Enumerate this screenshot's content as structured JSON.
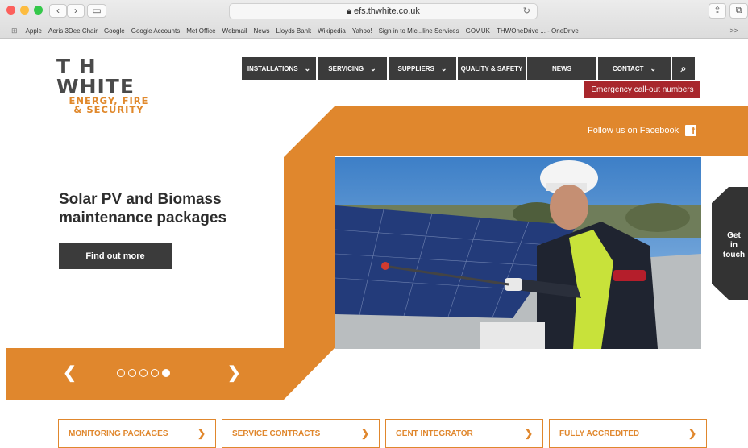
{
  "browser": {
    "url": "efs.thwhite.co.uk",
    "bookmarks": [
      "Apple",
      "Aeris 3Dee Chair",
      "Google",
      "Google Accounts",
      "Met Office",
      "Webmail",
      "News",
      "Lloyds Bank",
      "Wikipedia",
      "Yahoo!",
      "Sign in to Mic...line Services",
      "GOV.UK",
      "THWOneDrive ... - OneDrive"
    ],
    "bookmarks_more": ">>"
  },
  "logo": {
    "top": "T H WHITE",
    "line1": "ENERGY, FIRE",
    "line2": "& SECURITY"
  },
  "nav": {
    "items": [
      {
        "label": "INSTALLATIONS",
        "dropdown": true
      },
      {
        "label": "SERVICING",
        "dropdown": true
      },
      {
        "label": "SUPPLIERS",
        "dropdown": true
      },
      {
        "label": "QUALITY & SAFETY",
        "dropdown": false
      },
      {
        "label": "NEWS",
        "dropdown": false
      },
      {
        "label": "CONTACT",
        "dropdown": true
      }
    ],
    "emergency": "Emergency call-out numbers"
  },
  "social": {
    "follow_label": "Follow us on Facebook"
  },
  "hero": {
    "title": "Solar PV and Biomass maintenance packages",
    "cta": "Find out more",
    "slide_count": 5,
    "active_slide": 5
  },
  "get_in_touch": {
    "line1": "Get",
    "line2": "in",
    "line3": "touch"
  },
  "features": [
    {
      "label": "MONITORING PACKAGES"
    },
    {
      "label": "SERVICE CONTRACTS"
    },
    {
      "label": "GENT INTEGRATOR"
    },
    {
      "label": "FULLY ACCREDITED"
    }
  ],
  "colors": {
    "orange": "#e0872d",
    "dark": "#3b3b3b",
    "red": "#a8262c"
  }
}
